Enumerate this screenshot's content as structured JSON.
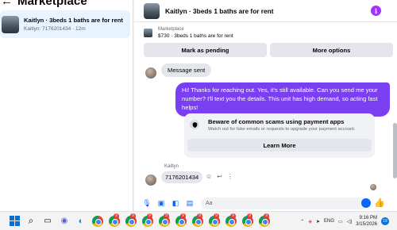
{
  "left": {
    "back_glyph": "←",
    "title": "Marketplace",
    "conversation": {
      "name": "Kaitlyn · 3beds 1 baths are for rent",
      "sub": "Kaitlyn: 7176201434 · 12m"
    }
  },
  "header": {
    "title": "Kaitlyn · 3beds 1 baths are for rent",
    "info_glyph": "i"
  },
  "listing": {
    "label": "Marketplace",
    "desc": "$730 · 3beds 1 baths are for rent"
  },
  "actions": {
    "pending_label": "Mark as pending",
    "more_label": "More options"
  },
  "messages": {
    "sent_label": "Message sent",
    "outgoing": "Hi! Thanks for reaching out. Yes, it's still available. Can you send me your number? I'll text you the details. This unit has high demand, so acting fast helps!",
    "scam_title": "Beware of common scams using payment apps",
    "scam_sub": "Watch out for fake emails or requests to upgrade your payment account.",
    "learn_more": "Learn More",
    "sender": "Kaitlyn",
    "reply": "7176201434"
  },
  "composer": {
    "placeholder": "Aa",
    "like_glyph": "👍"
  },
  "taskbar": {
    "lang": "ENG",
    "time": "9:16 PM",
    "date": "3/15/2026",
    "notif_count": "19",
    "badge_count": "9"
  },
  "colors": {
    "accent": "#7b3ff2",
    "messenger_blue": "#0866ff",
    "info_purple": "#a033ff"
  }
}
